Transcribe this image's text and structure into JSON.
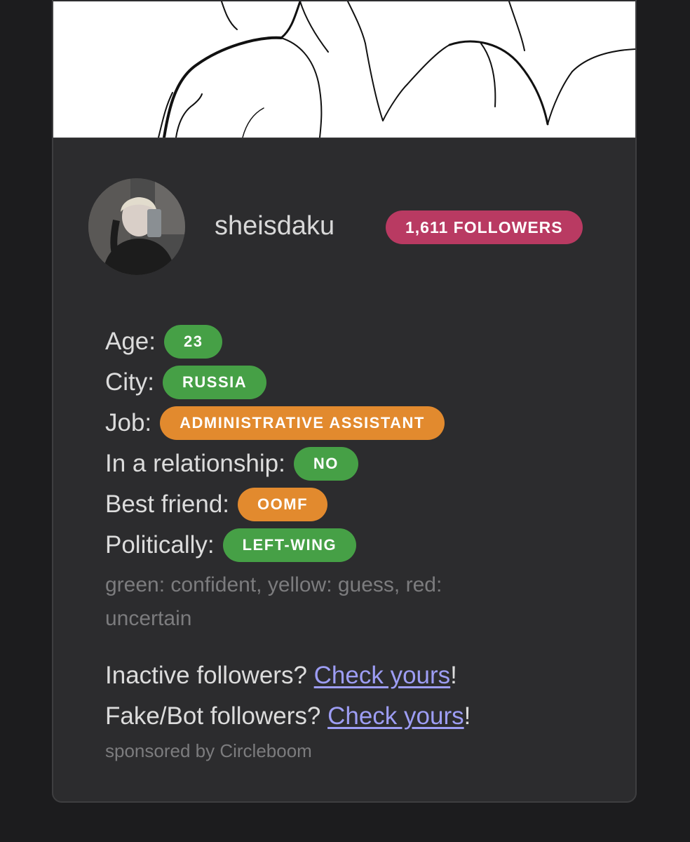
{
  "profile": {
    "username": "sheisdaku",
    "followers_badge": "1,611 FOLLOWERS"
  },
  "fields": [
    {
      "label": "Age:",
      "value": "23",
      "color": "#46a046"
    },
    {
      "label": "City:",
      "value": "RUSSIA",
      "color": "#46a046"
    },
    {
      "label": "Job:",
      "value": "ADMINISTRATIVE ASSISTANT",
      "color": "#e28a2e"
    },
    {
      "label": "In a relationship:",
      "value": "NO",
      "color": "#46a046"
    },
    {
      "label": "Best friend:",
      "value": "OOMF",
      "color": "#e28a2e"
    },
    {
      "label": "Politically:",
      "value": "LEFT-WING",
      "color": "#46a046"
    }
  ],
  "legend": "green: confident, yellow: guess, red: uncertain",
  "promo": {
    "inactive_prefix": "Inactive followers? ",
    "inactive_link": "Check yours",
    "inactive_suffix": "!",
    "fake_prefix": "Fake/Bot followers? ",
    "fake_link": "Check yours",
    "fake_suffix": "!",
    "sponsor": "sponsored by Circleboom"
  },
  "colors": {
    "background": "#1c1c1e",
    "card": "#2c2c2e",
    "followers_badge": "#b93a62",
    "pill_green": "#46a046",
    "pill_orange": "#e28a2e",
    "link": "#9d9df4"
  }
}
